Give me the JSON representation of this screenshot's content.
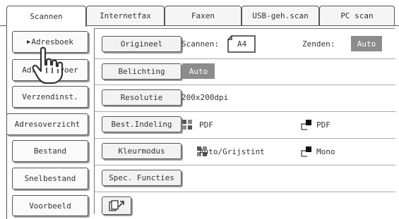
{
  "tabs": [
    "Scannen",
    "Internetfax",
    "Faxen",
    "USB-geh.scan",
    "PC scan"
  ],
  "left_buttons": {
    "address_book": "Adresboek",
    "address_entry": "Adres invoer",
    "send_settings": "Verzendinst.",
    "address_overview": "Adresoverzicht",
    "file": "Bestand",
    "quick_file": "Snelbestand",
    "preview": "Voorbeeld"
  },
  "settings": {
    "original": {
      "label": "Origineel",
      "scan_label": "Scannen:",
      "scan_value": "A4",
      "send_label": "Zenden:",
      "send_value": "Auto"
    },
    "exposure": {
      "label": "Belichting",
      "value": "Auto"
    },
    "resolution": {
      "label": "Resolutie",
      "value": "200x200dpi"
    },
    "file_format": {
      "label": "Best.Indeling",
      "color_value": "PDF",
      "mono_value": "PDF"
    },
    "color_mode": {
      "label": "Kleurmodus",
      "color_value": "Auto/Grijstint",
      "mono_value": "Mono"
    },
    "special": {
      "label": "Spec. Functies"
    }
  },
  "icons": {
    "selected_arrow": "play-triangle",
    "pointer": "hand-pointer-icon",
    "paper": "paper-a4-icon",
    "color_scan": "grid-icon",
    "mono_scan": "mono-icon",
    "program": "program-icon"
  },
  "colors": {
    "badge": "#8c8c8c",
    "border": "#555555"
  }
}
